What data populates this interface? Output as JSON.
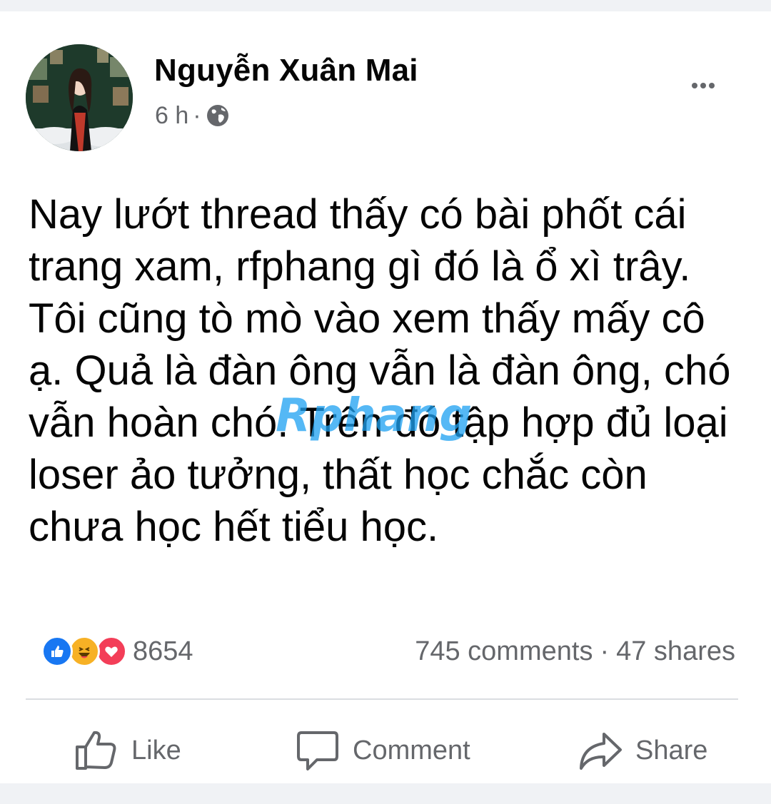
{
  "post": {
    "author": "Nguyễn Xuân Mai",
    "time": "6 h",
    "separator": "·",
    "privacy_icon": "globe-icon",
    "text": "Nay lướt thread thấy có bài phốt cái trang xam, rfphang gì đó là ổ xì trây. Tôi cũng tò mò vào xem thấy mấy cô ạ. Quả là đàn ông vẫn là đàn ông, chó vẫn hoàn chó. Trên đó tập hợp đủ loại loser ảo tưởng, thất học chắc còn chưa học hết tiểu học."
  },
  "watermark": {
    "text": "Rphang"
  },
  "engagement": {
    "reaction_icons": [
      "like-icon",
      "haha-icon",
      "love-icon"
    ],
    "reaction_count": "8654",
    "comments": "745 comments",
    "separator": "·",
    "shares": "47 shares"
  },
  "actions": {
    "like": "Like",
    "comment": "Comment",
    "share": "Share"
  },
  "colors": {
    "background": "#f0f2f5",
    "card": "#ffffff",
    "text": "#050505",
    "secondary_text": "#65676b",
    "like_blue": "#1877f2",
    "love_red": "#f33e58",
    "haha_yellow": "#f7b125"
  }
}
